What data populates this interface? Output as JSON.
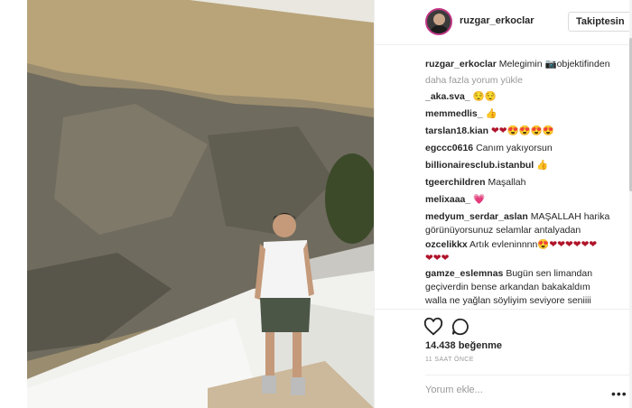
{
  "post": {
    "username": "ruzgar_erkoclar",
    "follow_label": "Takiptesin",
    "caption_user": "ruzgar_erkoclar",
    "caption_text": "Melegimin ",
    "caption_text2": "objektifinden",
    "load_more": "daha fazla yorum yükle"
  },
  "comments": [
    {
      "user": "_aka.sva_",
      "text": "",
      "emoji": "😌😌"
    },
    {
      "user": "memmedlis_",
      "text": "",
      "emoji": "👍"
    },
    {
      "user": "tarslan18.kian",
      "text": "",
      "emoji": "❤❤😍😍😍😍"
    },
    {
      "user": "egccc0616",
      "text": "Canım yakıyorsun",
      "emoji": ""
    },
    {
      "user": "billionairesclub.istanbul",
      "text": "",
      "emoji": "👍"
    },
    {
      "user": "tgeerchildren",
      "text": "Maşallah",
      "emoji": ""
    },
    {
      "user": "melixaaa_",
      "text": "",
      "emoji": "💗"
    },
    {
      "user": "medyum_serdar_aslan",
      "text": "MAŞALLAH harika",
      "line2": "görünüyorsunuz selamlar antalyadan"
    },
    {
      "user": "ozcelikkx",
      "text": "Artık evleninnnn",
      "emoji": "😍❤❤❤❤❤❤",
      "line2": "❤❤❤"
    },
    {
      "user": "gamze_eslemnas",
      "text": "Bugün sen limandan",
      "line2": "geçiverdin bense arkandan bakakaldım",
      "line3": "walla ne yağlan söyliyim seviyore seniiii"
    }
  ],
  "actions": {
    "likes": "14.438 beğenme",
    "time": "11 SAAT ÖNCE",
    "comment_placeholder": "Yorum ekle...",
    "more": "•••"
  },
  "icons": {
    "like": "heart-icon",
    "comment": "comment-bubble-icon",
    "camera": "camera-icon",
    "options": "more-options-icon"
  }
}
